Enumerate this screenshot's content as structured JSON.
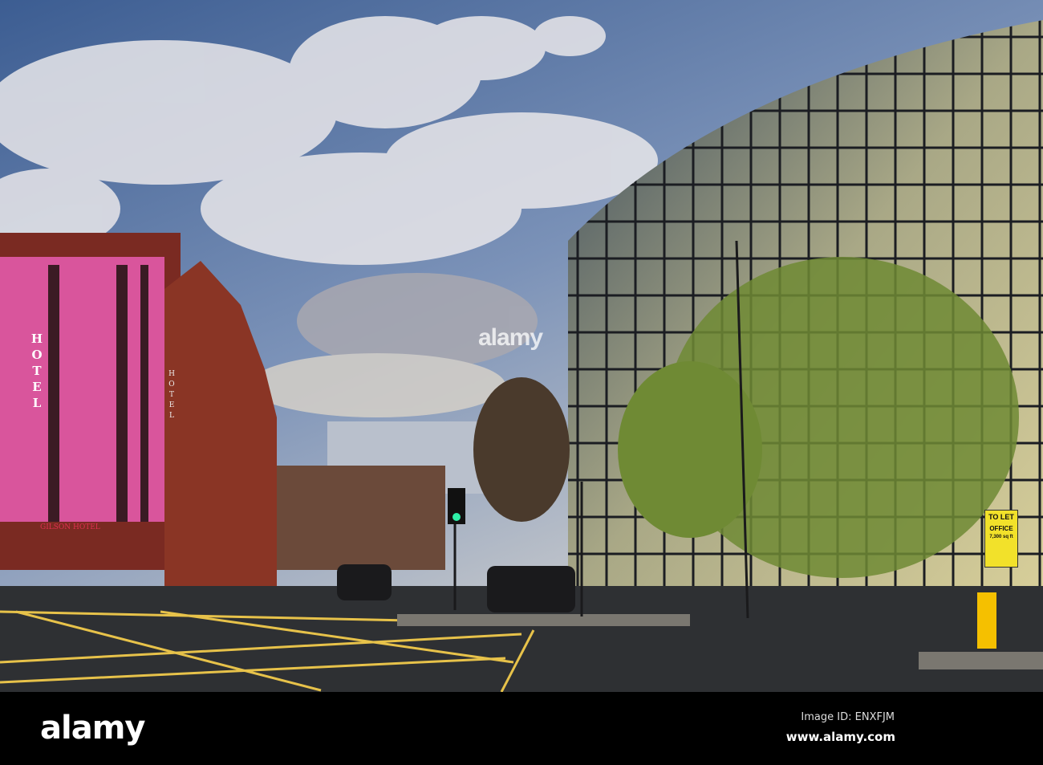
{
  "scene": {
    "signs": {
      "hotel_vertical": "HOTEL",
      "hotel_vertical_2": "HOTEL",
      "shop_sign": "GILSON HOTEL",
      "to_let_title": "TO LET",
      "to_let_office": "OFFICE",
      "to_let_area": "7,300 sq ft"
    }
  },
  "watermark": {
    "text": "alamy"
  },
  "footer": {
    "logo": "alamy",
    "image_id": "Image ID: ENXFJM",
    "url": "www.alamy.com"
  },
  "colors": {
    "sky": "#5b7fb0",
    "hotel_pink": "#d9559c",
    "brick": "#7a2a22",
    "road": "#2e3033",
    "road_lines": "#e7c24a"
  }
}
